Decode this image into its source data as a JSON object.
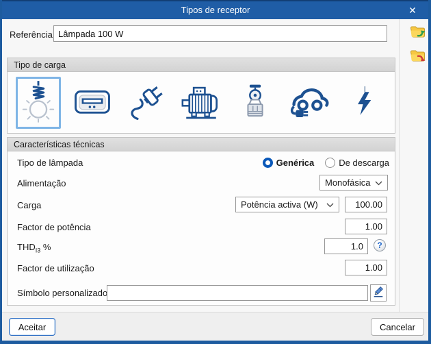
{
  "window": {
    "title": "Tipos de receptor",
    "close_glyph": "✕"
  },
  "reference": {
    "label": "Referência",
    "value": "Lâmpada 100 W"
  },
  "load_type": {
    "title": "Tipo de carga",
    "options": [
      {
        "name": "lamp",
        "selected": true
      },
      {
        "name": "hvac-unit",
        "selected": false
      },
      {
        "name": "plug-load",
        "selected": false
      },
      {
        "name": "motor",
        "selected": false
      },
      {
        "name": "lift",
        "selected": false
      },
      {
        "name": "ev-charger",
        "selected": false
      },
      {
        "name": "generic-load",
        "selected": false
      }
    ]
  },
  "tech": {
    "title": "Características técnicas",
    "lamp_type": {
      "label": "Tipo de lâmpada",
      "options": [
        {
          "label": "Genérica",
          "selected": true
        },
        {
          "label": "De descarga",
          "selected": false
        }
      ]
    },
    "supply": {
      "label": "Alimentação",
      "value": "Monofásica"
    },
    "load": {
      "label": "Carga",
      "quantity": "Potência activa (W)",
      "value": "100.00"
    },
    "power_factor": {
      "label": "Factor de potência",
      "value": "1.00"
    },
    "thd": {
      "label_base": "THD",
      "label_sub": "I3",
      "label_unit": "%",
      "value": "1.0",
      "help_glyph": "?"
    },
    "utilization": {
      "label": "Factor de utilização",
      "value": "1.00"
    },
    "symbol": {
      "label": "Símbolo personalizado",
      "value": ""
    }
  },
  "footer": {
    "accept": "Aceitar",
    "cancel": "Cancelar"
  },
  "colors": {
    "titlebar": "#1f5da6",
    "icon_blue": "#1d5191",
    "selected_tile_border": "#7fb5e6"
  }
}
